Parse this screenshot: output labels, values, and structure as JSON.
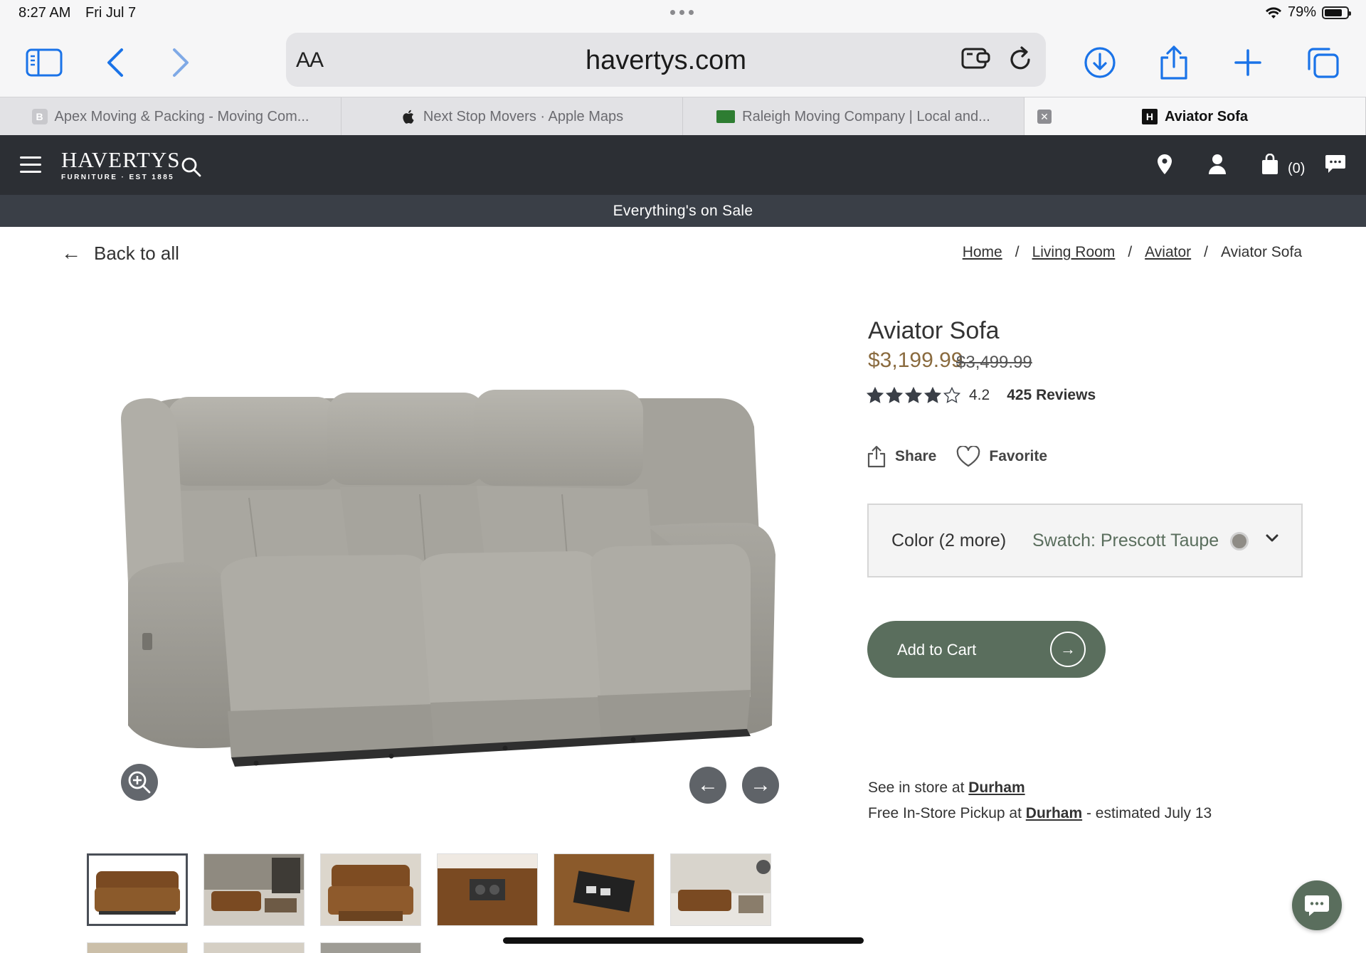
{
  "status_bar": {
    "time": "8:27 AM",
    "date": "Fri Jul 7",
    "battery": "79%",
    "battery_level": 0.79
  },
  "browser": {
    "aa_label": "AA",
    "url": "havertys.com",
    "tabs": [
      {
        "label": "Apex Moving & Packing - Moving Com...",
        "favicon": "B"
      },
      {
        "label": "Next Stop Movers · Apple Maps",
        "favicon": "apple-icon"
      },
      {
        "label": "Raleigh Moving Company | Local and...",
        "favicon": "site-icon"
      },
      {
        "label": "Aviator Sofa",
        "favicon": "H",
        "active": true
      }
    ]
  },
  "site": {
    "logo_name": "HAVERTYS",
    "logo_tagline": "FURNITURE · EST 1885",
    "cart_count": "(0)",
    "sale_banner": "Everything's on Sale",
    "colors": {
      "header": "#2c2f34",
      "banner": "#3a3f47",
      "accent": "#5a6e5d",
      "price": "#8a6b3f"
    }
  },
  "page": {
    "back_label": "Back to all",
    "breadcrumb": [
      "Home",
      "Living Room",
      "Aviator",
      "Aviator Sofa"
    ],
    "breadcrumb_sep": "/"
  },
  "product": {
    "title": "Aviator Sofa",
    "price": "$3,199.99",
    "old_price": "$3,499.99",
    "rating": "4.2",
    "rating_value": 4.2,
    "reviews": "425 Reviews",
    "share_label": "Share",
    "favorite_label": "Favorite",
    "color_label": "Color (2 more)",
    "swatch_label": "Swatch: Prescott Taupe",
    "add_to_cart": "Add to Cart",
    "see_in_store_prefix": "See in store at",
    "store_name": "Durham",
    "pickup_prefix": "Free In-Store Pickup at",
    "pickup_store": "Durham",
    "pickup_suffix": "- estimated July 13"
  }
}
